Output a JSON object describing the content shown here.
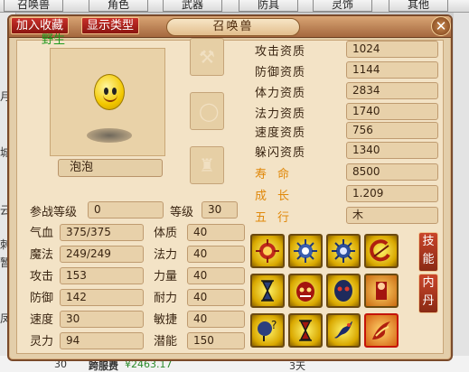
{
  "background": {
    "tabs": [
      "召唤兽",
      "角色",
      "武器",
      "防具",
      "灵饰",
      "其他"
    ],
    "left_chars": [
      "月",
      "城",
      "云",
      "刺",
      "暂",
      "凤"
    ],
    "bottom": {
      "count": "30",
      "server_label": "跨服费",
      "price": "¥2463.17",
      "days": "3天"
    }
  },
  "window": {
    "title": "召唤兽",
    "buttons": {
      "favorite": "加入收藏",
      "show_type": "显示类型"
    },
    "close": "✕"
  },
  "pet": {
    "type_label": "野生",
    "name": "泡泡"
  },
  "aptitudes": [
    {
      "label": "攻击资质",
      "value": "1024"
    },
    {
      "label": "防御资质",
      "value": "1144"
    },
    {
      "label": "体力资质",
      "value": "2834"
    },
    {
      "label": "法力资质",
      "value": "1740"
    },
    {
      "label": "速度资质",
      "value": "756"
    },
    {
      "label": "躲闪资质",
      "value": "1340"
    }
  ],
  "lifespan": {
    "label": "寿命",
    "value": "8500"
  },
  "growth": {
    "label": "成长",
    "value": "1.209"
  },
  "element": {
    "label": "五行",
    "value": "木"
  },
  "battle_level": {
    "label": "参战等级",
    "value": "0"
  },
  "level": {
    "label": "等级",
    "value": "30"
  },
  "stats_left": [
    {
      "label": "气血",
      "value": "375/375"
    },
    {
      "label": "魔法",
      "value": "249/249"
    },
    {
      "label": "攻击",
      "value": "153"
    },
    {
      "label": "防御",
      "value": "142"
    },
    {
      "label": "速度",
      "value": "30"
    },
    {
      "label": "灵力",
      "value": "94"
    }
  ],
  "stats_right": [
    {
      "label": "体质",
      "value": "40"
    },
    {
      "label": "法力",
      "value": "40"
    },
    {
      "label": "力量",
      "value": "40"
    },
    {
      "label": "耐力",
      "value": "40"
    },
    {
      "label": "敏捷",
      "value": "40"
    },
    {
      "label": "潜能",
      "value": "150"
    }
  ],
  "side_tabs": {
    "skills": "技能",
    "inner": "内丹"
  },
  "skill_icons": [
    "fire-sun-icon",
    "sun-icon",
    "sun-blue-icon",
    "swirl-icon",
    "hourglass-icon",
    "demon-mask-icon",
    "spirit-mask-icon",
    "warrior-icon",
    "question-scroll-icon",
    "hourglass-red-icon",
    "dragon-icon",
    "phoenix-icon"
  ]
}
